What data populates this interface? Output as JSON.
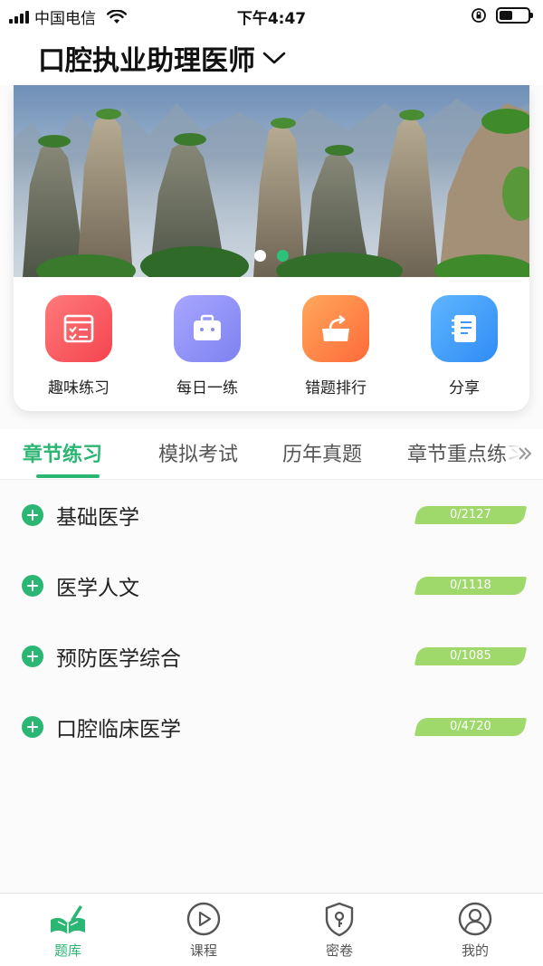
{
  "status_bar": {
    "carrier": "中国电信",
    "time": "下午4:47"
  },
  "header": {
    "title": "口腔执业助理医师",
    "dropdown_icon": "chevron-down-icon"
  },
  "banner": {
    "image": "mountain-landscape",
    "slide_count": 2,
    "active_slide": 2
  },
  "shortcuts": [
    {
      "label": "趣味练习",
      "icon": "checklist-icon",
      "color_from": "#ff7a7a",
      "color_to": "#f4444f"
    },
    {
      "label": "每日一练",
      "icon": "briefcase-icon",
      "color_from": "#a8a6ff",
      "color_to": "#7e82f0"
    },
    {
      "label": "错题排行",
      "icon": "export-box-icon",
      "color_from": "#ffa85a",
      "color_to": "#ff6a3a"
    },
    {
      "label": "分享",
      "icon": "notebook-icon",
      "color_from": "#5fb6ff",
      "color_to": "#2f8cf5"
    }
  ],
  "tabs": [
    {
      "label": "章节练习",
      "active": true
    },
    {
      "label": "模拟考试",
      "active": false
    },
    {
      "label": "历年真题",
      "active": false
    },
    {
      "label": "章节重点练习",
      "active": false
    }
  ],
  "chapters": [
    {
      "label": "基础医学",
      "progress": "0/2127"
    },
    {
      "label": "医学人文",
      "progress": "0/1118"
    },
    {
      "label": "预防医学综合",
      "progress": "0/1085"
    },
    {
      "label": "口腔临床医学",
      "progress": "0/4720"
    }
  ],
  "bottom_nav": [
    {
      "label": "题库",
      "icon": "book-pen-icon",
      "active": true
    },
    {
      "label": "课程",
      "icon": "play-circle-icon",
      "active": false
    },
    {
      "label": "密卷",
      "icon": "shield-key-icon",
      "active": false
    },
    {
      "label": "我的",
      "icon": "user-circle-icon",
      "active": false
    }
  ],
  "colors": {
    "accent": "#2bb673",
    "badge": "#9fd86b"
  }
}
